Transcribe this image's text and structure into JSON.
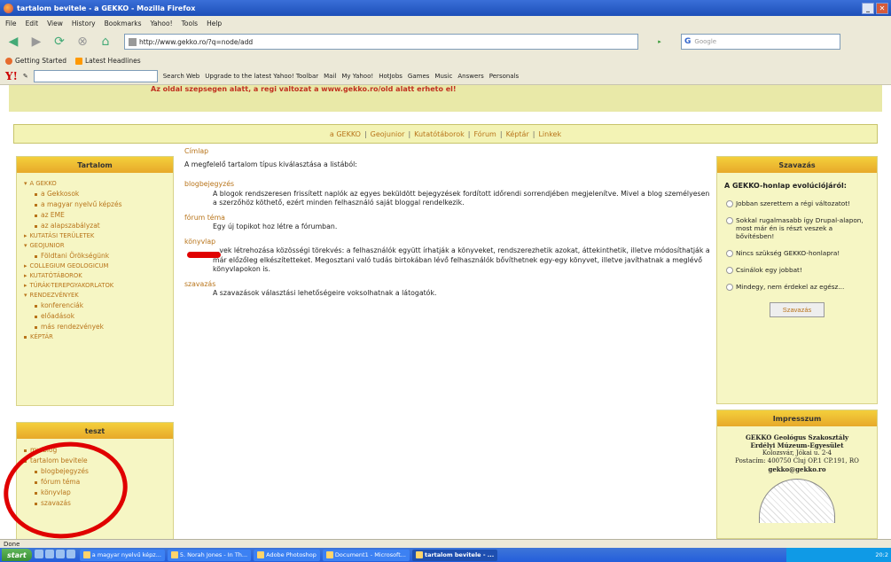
{
  "window": {
    "title": "tartalom bevitele - a GEKKO - Mozilla Firefox"
  },
  "menu": [
    "File",
    "Edit",
    "View",
    "History",
    "Bookmarks",
    "Yahoo!",
    "Tools",
    "Help"
  ],
  "nav": {
    "url": "http://www.gekko.ro/?q=node/add",
    "search_placeholder": "Google"
  },
  "bookmarks": [
    "Getting Started",
    "Latest Headlines"
  ],
  "yahoo_toolbar": {
    "logo": "Y!",
    "items": [
      "Search Web",
      "Upgrade to the latest Yahoo! Toolbar",
      "Mail",
      "My Yahoo!",
      "HotJobs",
      "Games",
      "Music",
      "Answers",
      "Personals"
    ]
  },
  "page": {
    "banner": "Az oldal szepsegen alatt, a regi valtozat a www.gekko.ro/old alatt erheto el!",
    "topnav": [
      "a GEKKO",
      "Geojunior",
      "Kutatótáborok",
      "Fórum",
      "Képtár",
      "Linkek"
    ],
    "left_block": {
      "title": "Tartalom",
      "items": [
        {
          "label": "A GEKKO",
          "level": 0,
          "mark": "down"
        },
        {
          "label": "a Gekkosok",
          "level": 1
        },
        {
          "label": "a magyar nyelvű képzés",
          "level": 1
        },
        {
          "label": "az EME",
          "level": 1
        },
        {
          "label": "az alapszabályzat",
          "level": 1
        },
        {
          "label": "KUTATÁSI TERÜLETEK",
          "level": 0,
          "mark": "right"
        },
        {
          "label": "GEOJUNIOR",
          "level": 0,
          "mark": "down"
        },
        {
          "label": "Földtani Örökségünk",
          "level": 1
        },
        {
          "label": "COLLEGIUM GEOLOGICUM",
          "level": 0,
          "mark": "right"
        },
        {
          "label": "KUTATÓTÁBOROK",
          "level": 0,
          "mark": "right"
        },
        {
          "label": "TÚRÁK-TEREPGYAKORLATOK",
          "level": 0,
          "mark": "right"
        },
        {
          "label": "RENDEZVÉNYEK",
          "level": 0,
          "mark": "down"
        },
        {
          "label": "konferenciák",
          "level": 1
        },
        {
          "label": "előadások",
          "level": 1
        },
        {
          "label": "más rendezvények",
          "level": 1
        },
        {
          "label": "KÉPTÁR",
          "level": 0,
          "mark": "bullet"
        }
      ]
    },
    "teszt_block": {
      "title": "teszt",
      "items": [
        {
          "label": "my blog",
          "level": 0
        },
        {
          "label": "tartalom bevitele",
          "level": 0
        },
        {
          "label": "blogbejegyzés",
          "level": 1
        },
        {
          "label": "fórum téma",
          "level": 1
        },
        {
          "label": "könyvlap",
          "level": 1
        },
        {
          "label": "szavazás",
          "level": 1
        }
      ]
    },
    "main": {
      "breadcrumb": "Címlap",
      "intro": "A megfelelő tartalom típus kiválasztása a listából:",
      "types": [
        {
          "title": "blogbejegyzés",
          "desc": "A blogok rendszeresen frissített naplók az egyes beküldött bejegyzések fordított időrendi sorrendjében megjelenítve. Mivel a blog személyesen a szerzőhöz köthető, ezért minden felhasználó saját bloggal rendelkezik."
        },
        {
          "title": "fórum téma",
          "desc": "Egy új topikot hoz létre a fórumban."
        },
        {
          "title": "könyvlap",
          "desc": "...vek létrehozása közösségi törekvés: a felhasználók együtt írhatják a könyveket, rendszerezhetik azokat, áttekinthetik, illetve módosíthatják a már előzőleg elkészítetteket. Megosztani való tudás birtokában lévő felhasználók bővíthetnek egy-egy könyvet, illetve javíthatnak a meglévő könyvlapokon is."
        },
        {
          "title": "szavazás",
          "desc": "A szavazások választási lehetőségeire voksolhatnak a látogatók."
        }
      ]
    },
    "poll": {
      "block_title": "Szavazás",
      "question": "A GEKKO-honlap evolúciójáról:",
      "options": [
        "Jobban szerettem a régi változatot!",
        "Sokkal rugalmasabb így Drupal-alapon, most már én is részt veszek a bővítésben!",
        "Nincs szükség GEKKO-honlapra!",
        "Csinálok egy jobbat!",
        "Mindegy, nem érdekel az egész..."
      ],
      "button": "Szavazás"
    },
    "impresszum": {
      "title": "Impresszum",
      "line1": "GEKKO Geológus Szakosztály",
      "line2": "Erdélyi Múzeum-Egyesület",
      "line3": "Kolozsvár, Jókai u. 2-4",
      "line4": "Postacím: 400750 Cluj OP.1 CP.191, RO",
      "email": "gekko@gekko.ro"
    }
  },
  "status": "Done",
  "taskbar": {
    "start": "start",
    "tasks": [
      {
        "label": "a magyar nyelvű képz...",
        "active": false
      },
      {
        "label": "5. Norah Jones - In Th...",
        "active": false
      },
      {
        "label": "Adobe Photoshop",
        "active": false
      },
      {
        "label": "Document1 - Microsoft...",
        "active": false
      },
      {
        "label": "tartalom bevitele - ...",
        "active": true
      }
    ],
    "clock": "20:2"
  }
}
